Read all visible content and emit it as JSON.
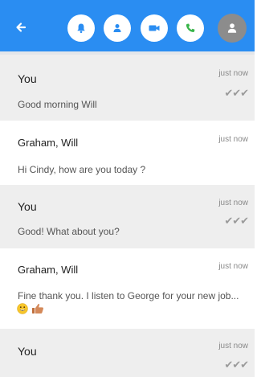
{
  "header": {
    "back_icon": "arrow-left-icon",
    "buttons": [
      {
        "name": "notifications-button",
        "icon": "bell-icon"
      },
      {
        "name": "contact-button",
        "icon": "person-icon"
      },
      {
        "name": "video-call-button",
        "icon": "video-camera-icon"
      },
      {
        "name": "voice-call-button",
        "icon": "phone-icon"
      }
    ],
    "avatar_icon": "person-icon",
    "accent_color": "#2a8df2"
  },
  "messages": [
    {
      "sender": "You",
      "time": "just now",
      "text": "Good morning Will",
      "read_ticks": "✔✔✔"
    },
    {
      "sender": "Graham, Will",
      "time": "just now",
      "text": "Hi Cindy, how are you today ?"
    },
    {
      "sender": "You",
      "time": "just now",
      "text": "Good! What about you?",
      "read_ticks": "✔✔✔"
    },
    {
      "sender": "Graham, Will",
      "time": "just now",
      "text": "Fine thank you. I listen to George for your new job...",
      "emojis": [
        "grinning-face-emoji",
        "thumbs-up-emoji"
      ]
    },
    {
      "sender": "You",
      "time": "just now",
      "read_ticks": "✔✔✔"
    }
  ]
}
